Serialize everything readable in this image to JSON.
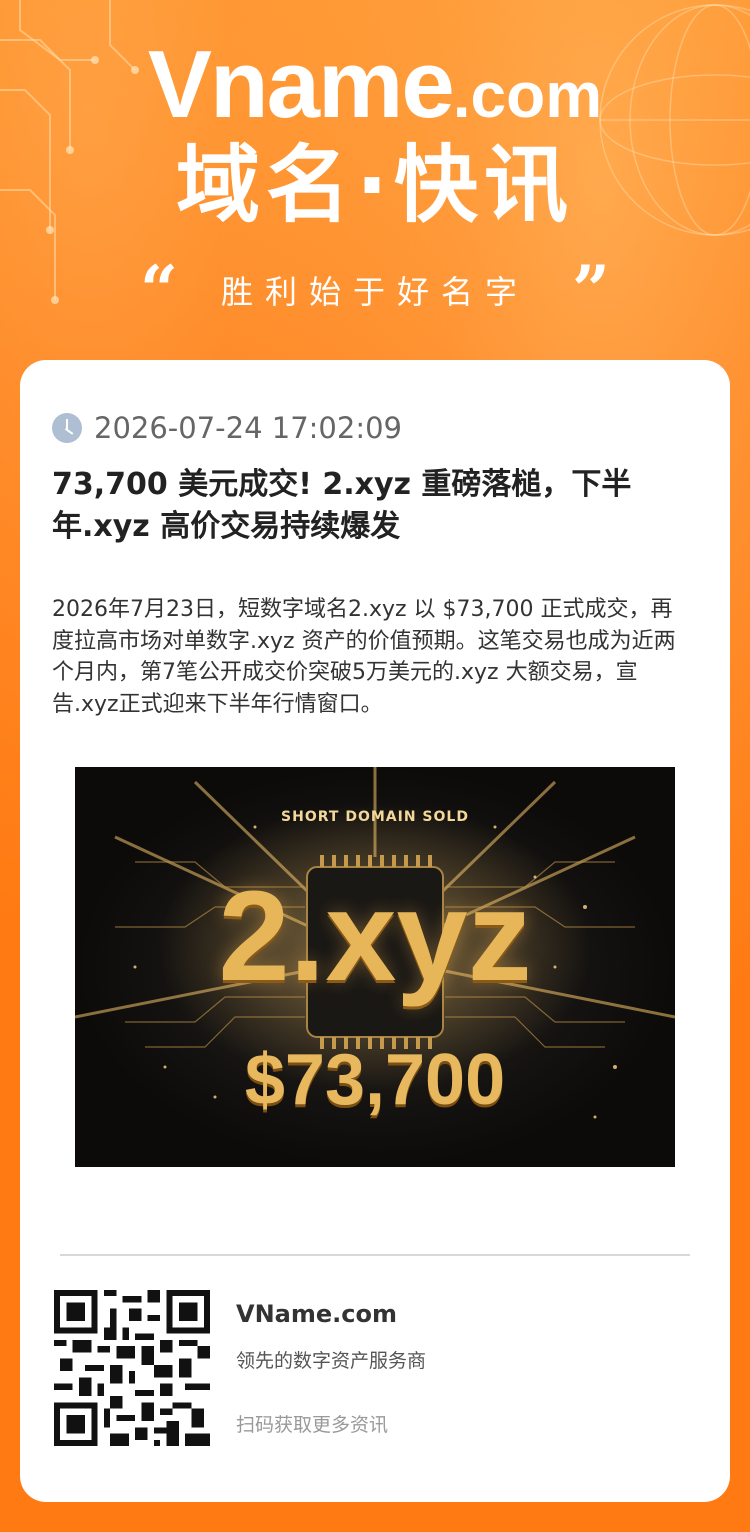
{
  "header": {
    "brand_main": "Vname",
    "brand_suffix": ".com",
    "headline": "域名·快讯",
    "quote_open": "“",
    "slogan": "胜利始于好名字",
    "quote_close": "”"
  },
  "article": {
    "timestamp": "2026-07-24 17:02:09",
    "title": "73,700 美元成交! 2.xyz 重磅落槌，下半年.xyz 高价交易持续爆发",
    "body": "2026年7月23日，短数字域名2.xyz 以 $73,700 正式成交，再度拉高市场对单数字.xyz 资产的价值预期。这笔交易也成为近两个月内，第7笔公开成交价突破5万美元的.xyz 大额交易，宣告.xyz正式迎来下半年行情窗口。"
  },
  "hero_image": {
    "tag": "SHORT DOMAIN SOLD",
    "domain": "2.xyz",
    "price": "$73,700"
  },
  "footer": {
    "brand": "VName.com",
    "description": "领先的数字资产服务商",
    "cta": "扫码获取更多资讯"
  },
  "colors": {
    "background": "#ff7a12",
    "card": "#ffffff",
    "gold": "#e7b658"
  },
  "icons": {
    "clock": "clock-icon",
    "qr": "qr-code"
  }
}
